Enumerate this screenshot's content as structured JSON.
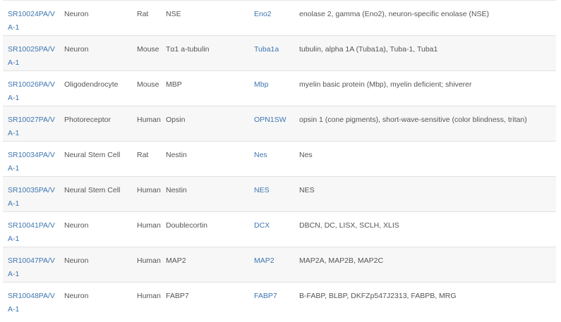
{
  "rows": [
    {
      "catalog": "SR10024PA/VA-1",
      "cell_type": "Neuron",
      "species": "Rat",
      "target": "NSE",
      "gene": "Eno2",
      "aliases": "enolase 2, gamma (Eno2), neuron-specific enolase (NSE)"
    },
    {
      "catalog": "SR10025PA/VA-1",
      "cell_type": "Neuron",
      "species": "Mouse",
      "target": "Tα1 a-tubulin",
      "gene": "Tuba1a",
      "aliases": "tubulin, alpha 1A (Tuba1a), Tuba-1, Tuba1"
    },
    {
      "catalog": "SR10026PA/VA-1",
      "cell_type": "Oligodendrocyte",
      "species": "Mouse",
      "target": "MBP",
      "gene": "Mbp",
      "aliases": "myelin basic protein (Mbp), myelin deficient; shiverer"
    },
    {
      "catalog": "SR10027PA/VA-1",
      "cell_type": "Photoreceptor",
      "species": "Human",
      "target": "Opsin",
      "gene": "OPN1SW",
      "aliases": "opsin 1 (cone pigments), short-wave-sensitive (color blindness, tritan)"
    },
    {
      "catalog": "SR10034PA/VA-1",
      "cell_type": "Neural Stem Cell",
      "species": "Rat",
      "target": "Nestin",
      "gene": "Nes",
      "aliases": "Nes"
    },
    {
      "catalog": "SR10035PA/VA-1",
      "cell_type": "Neural Stem Cell",
      "species": "Human",
      "target": "Nestin",
      "gene": "NES",
      "aliases": "NES"
    },
    {
      "catalog": "SR10041PA/VA-1",
      "cell_type": "Neuron",
      "species": "Human",
      "target": "Doublecortin",
      "gene": "DCX",
      "aliases": "DBCN, DC, LISX, SCLH, XLIS"
    },
    {
      "catalog": "SR10047PA/VA-1",
      "cell_type": "Neuron",
      "species": "Human",
      "target": "MAP2",
      "gene": "MAP2",
      "aliases": "MAP2A, MAP2B, MAP2C"
    },
    {
      "catalog": "SR10048PA/VA-1",
      "cell_type": "Neuron",
      "species": "Human",
      "target": "FABP7",
      "gene": "FABP7",
      "aliases": "B-FABP, BLBP, DKFZp547J2313, FABPB, MRG"
    }
  ],
  "colors": {
    "link": "#3f76b0",
    "text": "#555555",
    "alt_row": "#f7f7f7",
    "border": "#e3e3e3"
  }
}
